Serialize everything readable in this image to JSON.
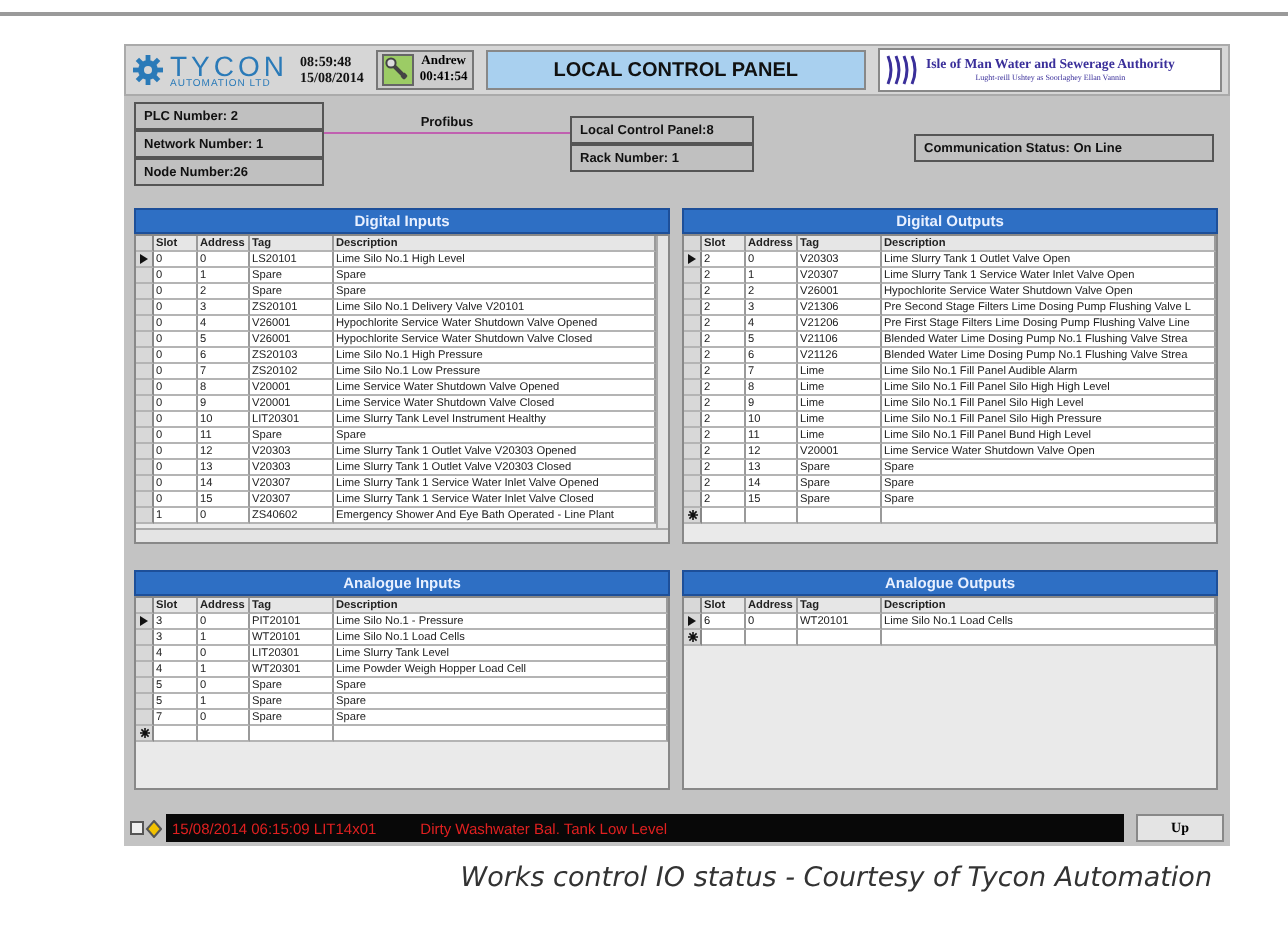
{
  "header": {
    "company": "TYCON",
    "company_sub": "AUTOMATION LTD",
    "time": "08:59:48",
    "date": "15/08/2014",
    "user": {
      "name": "Andrew",
      "time": "00:41:54"
    },
    "title": "LOCAL CONTROL PANEL",
    "authority": {
      "name": "Isle of Man Water and Sewerage Authority",
      "subtitle": "Lught-reill Ushtey as Soorlaghey Ellan Vannin"
    }
  },
  "network": {
    "plc": "PLC Number: 2",
    "network_number": "Network Number: 1",
    "node": "Node Number:26",
    "link": "Profibus",
    "panel": "Local Control Panel:8",
    "rack": "Rack Number: 1",
    "communication": "Communication Status: On Line"
  },
  "grids": [
    {
      "title": "Digital Inputs",
      "scrollable": true,
      "columns": [
        "Slot",
        "Address",
        "Tag",
        "Description"
      ],
      "rows": [
        {
          "kind": "data",
          "current": true,
          "cells": [
            "0",
            "0",
            "LS20101",
            "Lime Silo No.1 High Level"
          ]
        },
        {
          "kind": "data",
          "current": false,
          "cells": [
            "0",
            "1",
            "Spare",
            "Spare"
          ]
        },
        {
          "kind": "data",
          "current": false,
          "cells": [
            "0",
            "2",
            "Spare",
            "Spare"
          ]
        },
        {
          "kind": "data",
          "current": false,
          "cells": [
            "0",
            "3",
            "ZS20101",
            "Lime Silo No.1 Delivery Valve V20101"
          ]
        },
        {
          "kind": "data",
          "current": false,
          "cells": [
            "0",
            "4",
            "V26001",
            "Hypochlorite Service Water Shutdown Valve Opened"
          ]
        },
        {
          "kind": "data",
          "current": false,
          "cells": [
            "0",
            "5",
            "V26001",
            "Hypochlorite Service Water Shutdown Valve Closed"
          ]
        },
        {
          "kind": "data",
          "current": false,
          "cells": [
            "0",
            "6",
            "ZS20103",
            "Lime Silo No.1 High Pressure"
          ]
        },
        {
          "kind": "data",
          "current": false,
          "cells": [
            "0",
            "7",
            "ZS20102",
            "Lime Silo No.1 Low Pressure"
          ]
        },
        {
          "kind": "data",
          "current": false,
          "cells": [
            "0",
            "8",
            "V20001",
            "Lime Service Water Shutdown Valve Opened"
          ]
        },
        {
          "kind": "data",
          "current": false,
          "cells": [
            "0",
            "9",
            "V20001",
            "Lime Service Water Shutdown Valve Closed"
          ]
        },
        {
          "kind": "data",
          "current": false,
          "cells": [
            "0",
            "10",
            "LIT20301",
            "Lime Slurry Tank Level Instrument Healthy"
          ]
        },
        {
          "kind": "data",
          "current": false,
          "cells": [
            "0",
            "11",
            "Spare",
            "Spare"
          ]
        },
        {
          "kind": "data",
          "current": false,
          "cells": [
            "0",
            "12",
            "V20303",
            "Lime Slurry Tank 1 Outlet Valve V20303 Opened"
          ]
        },
        {
          "kind": "data",
          "current": false,
          "cells": [
            "0",
            "13",
            "V20303",
            "Lime Slurry Tank 1 Outlet Valve V20303 Closed"
          ]
        },
        {
          "kind": "data",
          "current": false,
          "cells": [
            "0",
            "14",
            "V20307",
            "Lime Slurry Tank 1 Service Water Inlet Valve Opened"
          ]
        },
        {
          "kind": "data",
          "current": false,
          "cells": [
            "0",
            "15",
            "V20307",
            "Lime Slurry Tank 1 Service Water Inlet Valve Closed"
          ]
        },
        {
          "kind": "data",
          "current": false,
          "cells": [
            "1",
            "0",
            "ZS40602",
            "Emergency Shower And Eye Bath Operated - Line Plant"
          ]
        }
      ]
    },
    {
      "title": "Digital Outputs",
      "scrollable": false,
      "columns": [
        "Slot",
        "Address",
        "Tag",
        "Description"
      ],
      "rows": [
        {
          "kind": "data",
          "current": true,
          "cells": [
            "2",
            "0",
            "V20303",
            "Lime Slurry Tank 1 Outlet Valve Open"
          ]
        },
        {
          "kind": "data",
          "current": false,
          "cells": [
            "2",
            "1",
            "V20307",
            "Lime Slurry Tank 1 Service Water Inlet Valve Open"
          ]
        },
        {
          "kind": "data",
          "current": false,
          "cells": [
            "2",
            "2",
            "V26001",
            "Hypochlorite Service Water Shutdown Valve Open"
          ]
        },
        {
          "kind": "data",
          "current": false,
          "cells": [
            "2",
            "3",
            "V21306",
            "Pre Second Stage Filters Lime Dosing Pump Flushing Valve L"
          ]
        },
        {
          "kind": "data",
          "current": false,
          "cells": [
            "2",
            "4",
            "V21206",
            "Pre First Stage Filters Lime Dosing Pump Flushing Valve Line"
          ]
        },
        {
          "kind": "data",
          "current": false,
          "cells": [
            "2",
            "5",
            "V21106",
            "Blended Water Lime Dosing Pump No.1 Flushing Valve Strea"
          ]
        },
        {
          "kind": "data",
          "current": false,
          "cells": [
            "2",
            "6",
            "V21126",
            "Blended Water Lime Dosing Pump No.1 Flushing Valve Strea"
          ]
        },
        {
          "kind": "data",
          "current": false,
          "cells": [
            "2",
            "7",
            "Lime",
            "Lime Silo No.1 Fill Panel Audible Alarm"
          ]
        },
        {
          "kind": "data",
          "current": false,
          "cells": [
            "2",
            "8",
            "Lime",
            "Lime Silo No.1 Fill Panel Silo High High Level"
          ]
        },
        {
          "kind": "data",
          "current": false,
          "cells": [
            "2",
            "9",
            "Lime",
            "Lime Silo No.1 Fill Panel Silo High Level"
          ]
        },
        {
          "kind": "data",
          "current": false,
          "cells": [
            "2",
            "10",
            "Lime",
            "Lime Silo No.1 Fill Panel Silo High Pressure"
          ]
        },
        {
          "kind": "data",
          "current": false,
          "cells": [
            "2",
            "11",
            "Lime",
            "Lime Silo No.1 Fill Panel Bund High Level"
          ]
        },
        {
          "kind": "data",
          "current": false,
          "cells": [
            "2",
            "12",
            "V20001",
            "Lime Service Water Shutdown Valve Open"
          ]
        },
        {
          "kind": "data",
          "current": false,
          "cells": [
            "2",
            "13",
            "Spare",
            "Spare"
          ]
        },
        {
          "kind": "data",
          "current": false,
          "cells": [
            "2",
            "14",
            "Spare",
            "Spare"
          ]
        },
        {
          "kind": "data",
          "current": false,
          "cells": [
            "2",
            "15",
            "Spare",
            "Spare"
          ]
        },
        {
          "kind": "new",
          "current": false,
          "cells": []
        }
      ]
    },
    {
      "title": "Analogue Inputs",
      "scrollable": false,
      "columns": [
        "Slot",
        "Address",
        "Tag",
        "Description"
      ],
      "rows": [
        {
          "kind": "data",
          "current": true,
          "cells": [
            "3",
            "0",
            "PIT20101",
            "Lime Silo No.1 - Pressure"
          ]
        },
        {
          "kind": "data",
          "current": false,
          "cells": [
            "3",
            "1",
            "WT20101",
            "Lime Silo No.1 Load Cells"
          ]
        },
        {
          "kind": "data",
          "current": false,
          "cells": [
            "4",
            "0",
            "LIT20301",
            "Lime Slurry Tank Level"
          ]
        },
        {
          "kind": "data",
          "current": false,
          "cells": [
            "4",
            "1",
            "WT20301",
            "Lime Powder Weigh Hopper Load Cell"
          ]
        },
        {
          "kind": "data",
          "current": false,
          "cells": [
            "5",
            "0",
            "Spare",
            "Spare"
          ]
        },
        {
          "kind": "data",
          "current": false,
          "cells": [
            "5",
            "1",
            "Spare",
            "Spare"
          ]
        },
        {
          "kind": "data",
          "current": false,
          "cells": [
            "7",
            "0",
            "Spare",
            "Spare"
          ]
        },
        {
          "kind": "new",
          "current": false,
          "cells": []
        }
      ]
    },
    {
      "title": "Analogue Outputs",
      "scrollable": false,
      "columns": [
        "Slot",
        "Address",
        "Tag",
        "Description"
      ],
      "rows": [
        {
          "kind": "data",
          "current": true,
          "cells": [
            "6",
            "0",
            "WT20101",
            "Lime Silo No.1 Load Cells"
          ]
        },
        {
          "kind": "new",
          "current": false,
          "cells": []
        }
      ]
    }
  ],
  "alarm": {
    "stamp": "15/08/2014  06:15:09  LIT14x01",
    "message": "Dirty Washwater Bal. Tank Low Level",
    "button": "Up"
  },
  "caption": "Works control IO status - Courtesy of Tycon Automation"
}
